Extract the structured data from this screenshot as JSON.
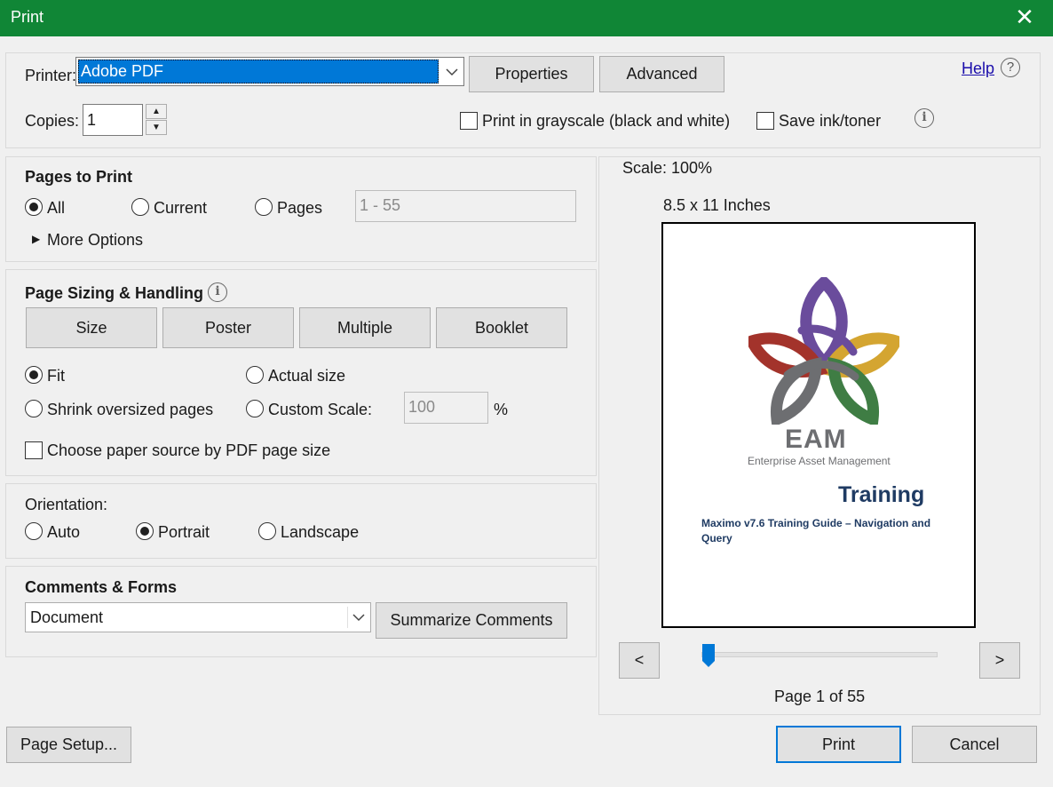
{
  "window": {
    "title": "Print",
    "close": "✕"
  },
  "top": {
    "printer_label": "Printer:",
    "printer_value": "Adobe PDF",
    "properties_button": "Properties",
    "advanced_button": "Advanced",
    "help_link": "Help",
    "copies_label": "Copies:",
    "copies_value": "1",
    "grayscale_label": "Print in grayscale (black and white)",
    "save_ink_label": "Save ink/toner"
  },
  "pages_to_print": {
    "heading": "Pages to Print",
    "all": "All",
    "current": "Current",
    "pages": "Pages",
    "pages_range": "1 - 55",
    "more_options": "More Options",
    "selected": "All"
  },
  "sizing": {
    "heading": "Page Sizing & Handling",
    "tabs": [
      "Size",
      "Poster",
      "Multiple",
      "Booklet"
    ],
    "fit": "Fit",
    "actual_size": "Actual size",
    "shrink": "Shrink oversized pages",
    "custom_scale": "Custom Scale:",
    "custom_scale_value": "100",
    "percent": "%",
    "paper_source": "Choose paper source by PDF page size",
    "selected": "Fit"
  },
  "orientation": {
    "heading": "Orientation:",
    "auto": "Auto",
    "portrait": "Portrait",
    "landscape": "Landscape",
    "selected": "Portrait"
  },
  "comments": {
    "heading": "Comments & Forms",
    "value": "Document",
    "summarize_button": "Summarize Comments"
  },
  "preview": {
    "scale": "Scale: 100%",
    "paper_size": "8.5 x 11 Inches",
    "logo_title": "EAM",
    "logo_subtitle": "Enterprise Asset Management",
    "doc_title": "Training",
    "doc_subtitle": "Maximo v7.6 Training Guide – Navigation and Query",
    "prev": "<",
    "next": ">",
    "page_status": "Page 1 of 55",
    "page_position": 1,
    "page_total": 55
  },
  "footer": {
    "page_setup": "Page Setup...",
    "print": "Print",
    "cancel": "Cancel"
  },
  "colors": {
    "titlebar": "#108636",
    "selection": "#0078d7",
    "logo_purple": "#6a4c9c",
    "logo_gold": "#d4a531",
    "logo_red": "#a3332b",
    "logo_green": "#3f7d44",
    "logo_gray": "#6d6e71",
    "doc_blue": "#1f3b63"
  }
}
